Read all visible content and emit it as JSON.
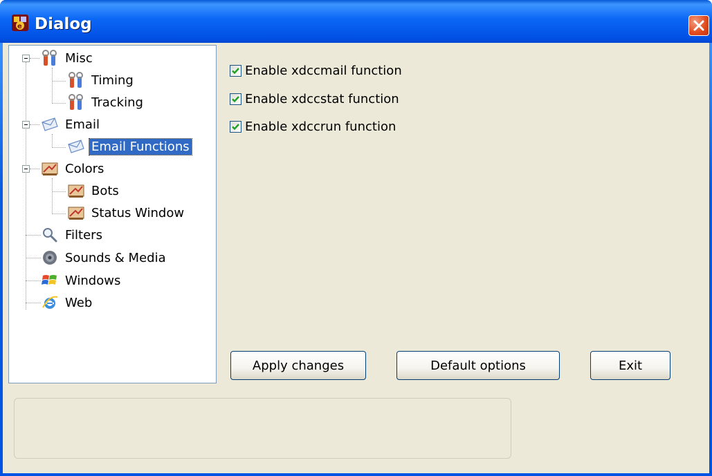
{
  "window": {
    "title": "Dialog"
  },
  "tree": {
    "items": [
      {
        "label": "Misc",
        "icon": "tools-icon",
        "level": 0,
        "expanded": true
      },
      {
        "label": "Timing",
        "icon": "tools-icon",
        "level": 1
      },
      {
        "label": "Tracking",
        "icon": "tools-icon",
        "level": 1
      },
      {
        "label": "Email",
        "icon": "email-icon",
        "level": 0,
        "expanded": true
      },
      {
        "label": "Email Functions",
        "icon": "email-icon",
        "level": 1,
        "selected": true
      },
      {
        "label": "Colors",
        "icon": "colors-icon",
        "level": 0,
        "expanded": true
      },
      {
        "label": "Bots",
        "icon": "colors-icon",
        "level": 1
      },
      {
        "label": "Status Window",
        "icon": "colors-icon",
        "level": 1
      },
      {
        "label": "Filters",
        "icon": "magnifier-icon",
        "level": 0
      },
      {
        "label": "Sounds & Media",
        "icon": "speaker-icon",
        "level": 0
      },
      {
        "label": "Windows",
        "icon": "windows-flag-icon",
        "level": 0
      },
      {
        "label": "Web",
        "icon": "internet-explorer-icon",
        "level": 0
      }
    ]
  },
  "options": [
    {
      "label": "Enable xdccmail function",
      "checked": true
    },
    {
      "label": "Enable xdccstat function",
      "checked": true
    },
    {
      "label": "Enable xdccrun function",
      "checked": true
    }
  ],
  "buttons": {
    "apply": "Apply changes",
    "defaults": "Default options",
    "exit": "Exit"
  },
  "colors": {
    "titlebar": "#0054e3",
    "selection": "#316ac5",
    "face": "#ece9d8"
  }
}
